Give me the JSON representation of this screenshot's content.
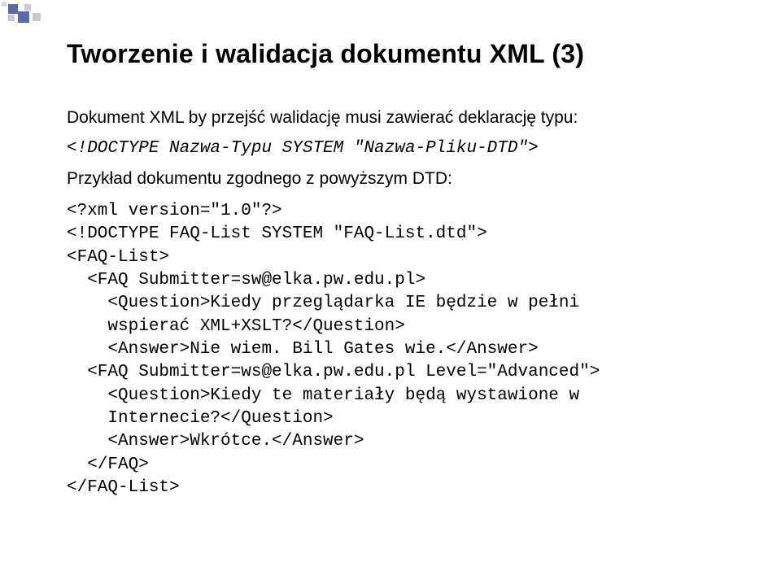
{
  "title": "Tworzenie i walidacja dokumentu XML (3)",
  "intro": "Dokument XML by przejść walidację musi zawierać deklarację typu:",
  "dtd_line": "<!DOCTYPE Nazwa-Typu SYSTEM \"Nazwa-Pliku-DTD\">",
  "example_label": "Przykład dokumentu zgodnego z powyższym DTD:",
  "code": "<?xml version=\"1.0\"?>\n<!DOCTYPE FAQ-List SYSTEM \"FAQ-List.dtd\">\n<FAQ-List>\n  <FAQ Submitter=sw@elka.pw.edu.pl>\n    <Question>Kiedy przeglądarka IE będzie w pełni\n    wspierać XML+XSLT?</Question>\n    <Answer>Nie wiem. Bill Gates wie.</Answer>\n  <FAQ Submitter=ws@elka.pw.edu.pl Level=\"Advanced\">\n    <Question>Kiedy te materiały będą wystawione w\n    Internecie?</Question>\n    <Answer>Wkrótce.</Answer>\n  </FAQ>\n</FAQ-List>"
}
